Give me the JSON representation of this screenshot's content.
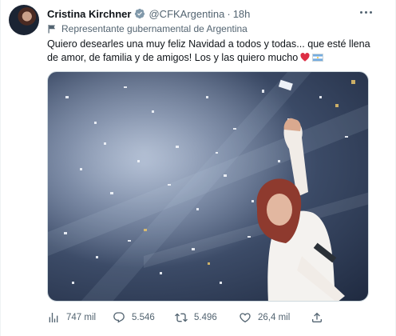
{
  "tweet": {
    "author_name": "Cristina Kirchner",
    "handle": "@CFKArgentina",
    "separator": "·",
    "time": "18h",
    "label": "Representante gubernamental de Argentina",
    "text": "Quiero desearles una muy feliz Navidad a todos y todas... que esté llena de amor, de familia y de amigos! Los y las quiero mucho",
    "emojis": [
      "red-heart",
      "flag-argentina"
    ]
  },
  "actions": {
    "views": "747 mil",
    "replies": "5.546",
    "retweets": "5.496",
    "likes": "26,4 mil"
  },
  "icons": {
    "verified": "verified-badge-icon",
    "more": "more-options-icon",
    "label": "government-flag-icon",
    "views": "views-chart-icon",
    "reply": "reply-icon",
    "retweet": "retweet-icon",
    "like": "heart-icon",
    "share": "share-icon"
  },
  "colors": {
    "text": "#0f1419",
    "secondary": "#536471",
    "verified": "#829aab",
    "heart": "#dd2e44",
    "flag_blue": "#74acdf"
  }
}
